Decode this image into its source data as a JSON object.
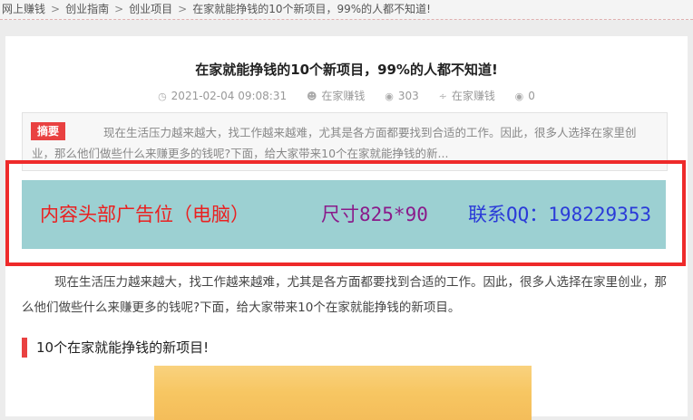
{
  "breadcrumb": {
    "items": [
      "网上赚钱",
      "创业指南",
      "创业项目",
      "在家就能挣钱的10个新项目，99%的人都不知道!"
    ],
    "separator": ">"
  },
  "article": {
    "title": "在家就能挣钱的10个新项目，99%的人都不知道!",
    "meta": {
      "date": "2021-02-04 09:08:31",
      "author": "在家赚钱",
      "views": "303",
      "category": "在家赚钱",
      "comments": "0"
    },
    "summary_tag": "摘要",
    "summary_text": "现在生活压力越来越大，找工作越来越难，尤其是各方面都要找到合适的工作。因此，很多人选择在家里创业，那么他们做些什么来赚更多的钱呢?下面，给大家带来10个在家就能挣钱的新...",
    "intro": "现在生活压力越来越大，找工作越来越难，尤其是各方面都要找到合适的工作。因此，很多人选择在家里创业，那么他们做些什么来赚更多的钱呢?下面，给大家带来10个在家就能挣钱的新项目。",
    "section_heading": "10个在家就能挣钱的新项目!"
  },
  "ad": {
    "label": "内容头部广告位（电脑）",
    "size": "尺寸825*90",
    "contact": "联系QQ：198229353"
  },
  "colors": {
    "accent": "#e94141",
    "ad_border": "#ee2a2a",
    "ad_bg": "#9cd0d2"
  },
  "icons": {
    "date": "clock-icon",
    "author": "user-icon",
    "views": "eye-icon",
    "category": "rss-icon",
    "comments": "comment-icon"
  }
}
